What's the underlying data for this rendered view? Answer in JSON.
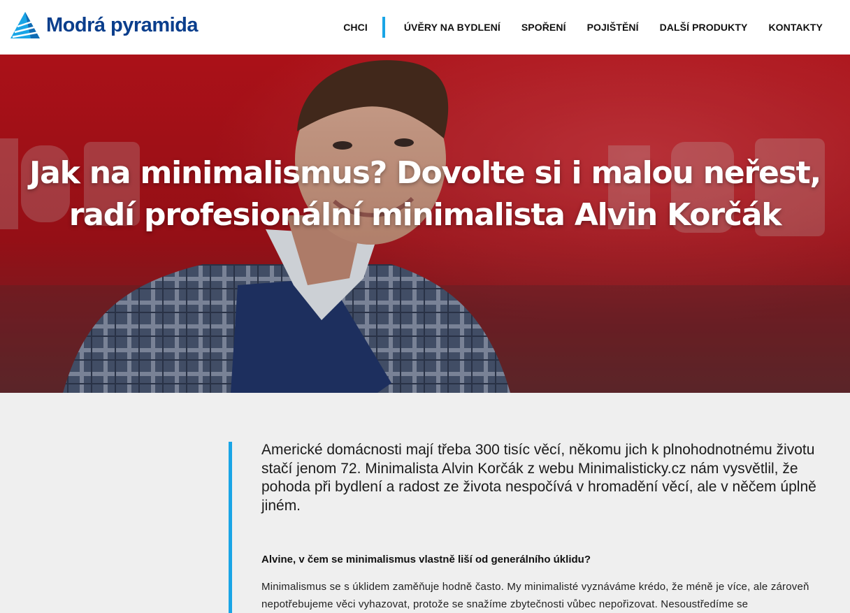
{
  "header": {
    "logo_text": "Modrá pyramida",
    "nav": [
      {
        "label": "CHCI"
      },
      {
        "label": "ÚVĚRY NA BYDLENÍ"
      },
      {
        "label": "SPOŘENÍ"
      },
      {
        "label": "POJIŠTĚNÍ"
      },
      {
        "label": "DALŠÍ PRODUKTY"
      },
      {
        "label": "KONTAKTY"
      }
    ]
  },
  "hero": {
    "title": "Jak na minimalismus? Dovolte si i malou neřest, radí profesionální minimalista Alvin Korčák"
  },
  "article": {
    "lead": "Americké domácnosti mají třeba 300 tisíc věcí, někomu jich k plnohodnotnému životu stačí jenom 72. Minimalista Alvin Korčák z webu Minimalisticky.cz nám vysvětlil, že pohoda při bydlení a radost ze života nespočívá v hromadění věcí, ale v něčem úplně jiném.",
    "question": "Alvine, v čem se minimalismus vlastně liší od generálního úklidu?",
    "answer": "Minimalismus se s úklidem zaměňuje hodně často. My minimalisté vyznáváme krédo, že méně je více, ale zároveň nepotřebujeme věci vyhazovat, protože se snažíme zbytečnosti vůbec nepořizovat. Nesoustředíme se"
  },
  "colors": {
    "brand_blue": "#0a3e8c",
    "accent_blue": "#19a5e6",
    "hero_red": "#b2161d",
    "content_bg": "#efefef"
  }
}
